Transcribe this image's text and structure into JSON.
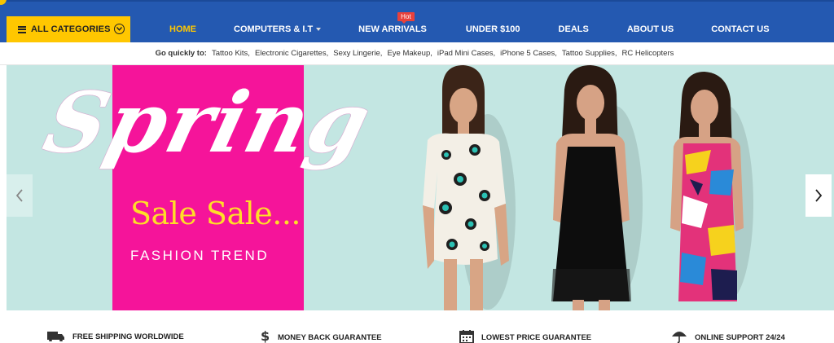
{
  "header": {
    "all_categories": "ALL CATEGORIES",
    "menu": [
      {
        "label": "HOME",
        "active": true
      },
      {
        "label": "COMPUTERS & I.T",
        "has_dropdown": true
      },
      {
        "label": "NEW ARRIVALS",
        "badge": "Hot"
      },
      {
        "label": "UNDER $100"
      },
      {
        "label": "DEALS"
      },
      {
        "label": "ABOUT US"
      },
      {
        "label": "CONTACT US"
      }
    ]
  },
  "quick_links": {
    "label": "Go quickly to:",
    "links": [
      "Tattoo Kits,",
      "Electronic Cigarettes,",
      "Sexy Lingerie,",
      "Eye Makeup,",
      "iPad Mini Cases,",
      "iPhone 5 Cases,",
      "Tattoo Supplies,",
      "RC Helicopters"
    ]
  },
  "banner": {
    "headline": "Spring",
    "subhead": "Sale Sale...",
    "tagline": "FASHION TREND"
  },
  "features": [
    {
      "label": "FREE SHIPPING WORLDWIDE",
      "icon": "truck-icon"
    },
    {
      "label": "MONEY BACK GUARANTEE",
      "icon": "dollar-icon"
    },
    {
      "label": "LOWEST PRICE GUARANTEE",
      "icon": "calendar-icon"
    },
    {
      "label": "ONLINE SUPPORT 24/24",
      "icon": "umbrella-icon"
    }
  ],
  "colors": {
    "nav_bg": "#2459b1",
    "accent_yellow": "#ffc700",
    "banner_bg": "#c3e6e2",
    "banner_pink": "#f5149a",
    "hot_badge": "#e8413b"
  }
}
